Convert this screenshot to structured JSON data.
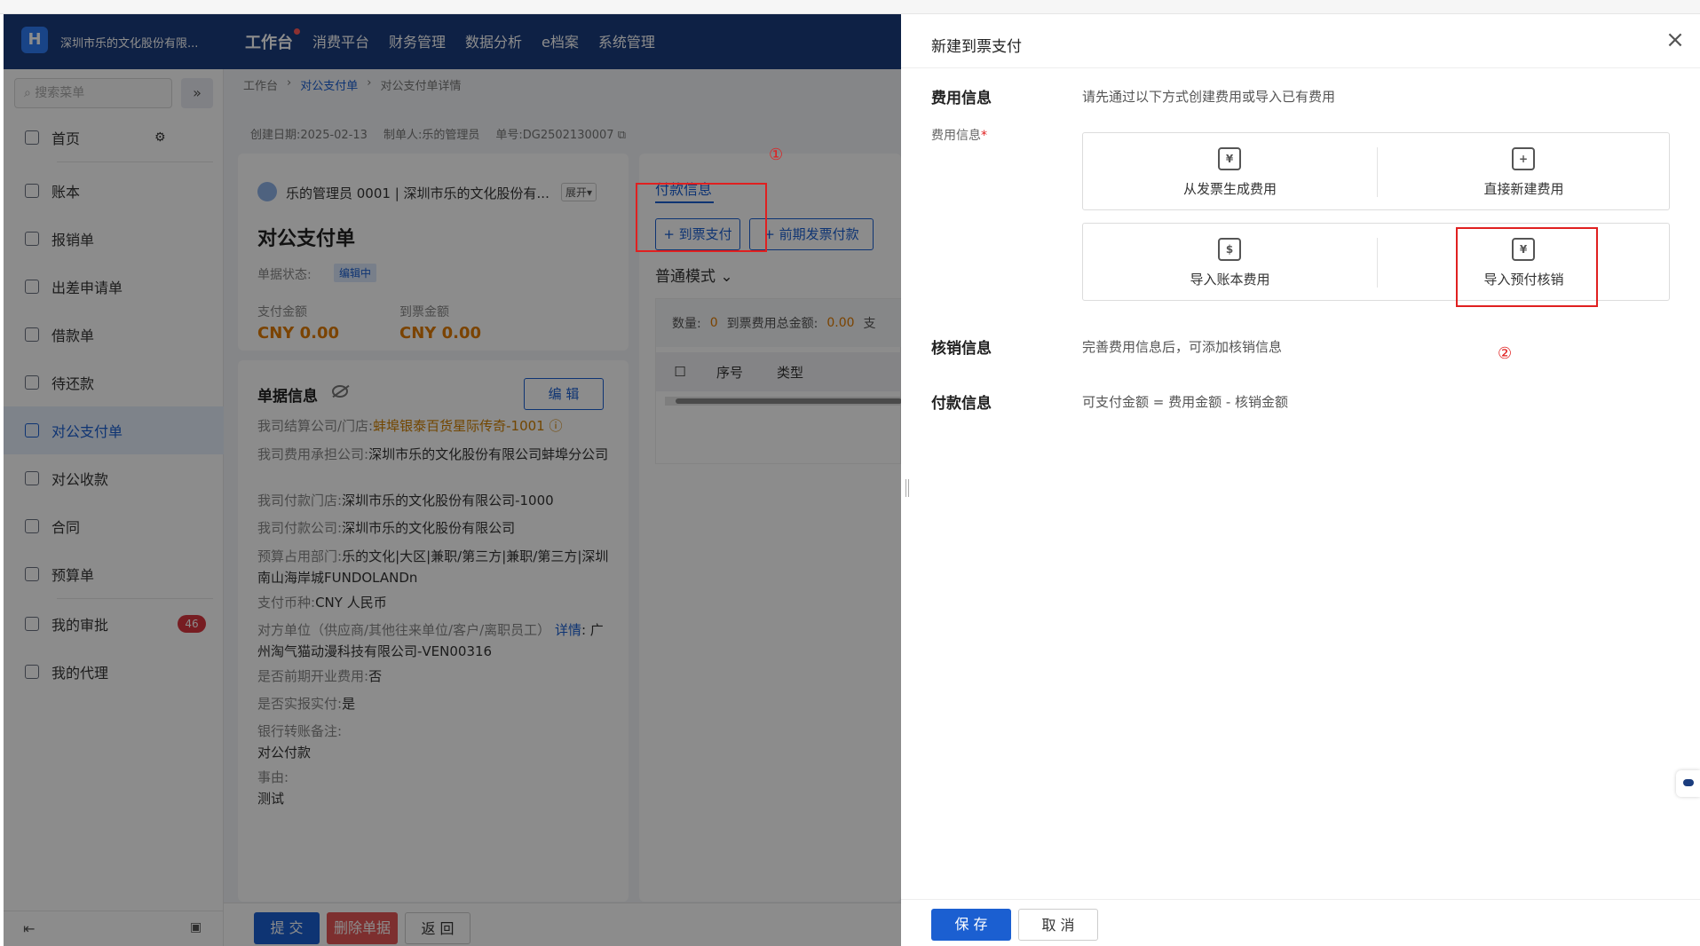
{
  "header": {
    "company": "深圳市乐的文化股份有限...",
    "nav": [
      "工作台",
      "消费平台",
      "财务管理",
      "数据分析",
      "e档案",
      "系统管理"
    ],
    "active_nav": "工作台"
  },
  "sidebar": {
    "search_placeholder": "搜索菜单",
    "items": [
      {
        "label": "首页"
      },
      {
        "label": "账本"
      },
      {
        "label": "报销单"
      },
      {
        "label": "出差申请单"
      },
      {
        "label": "借款单"
      },
      {
        "label": "待还款"
      },
      {
        "label": "对公支付单"
      },
      {
        "label": "对公收款"
      },
      {
        "label": "合同"
      },
      {
        "label": "预算单"
      },
      {
        "label": "我的审批",
        "badge": "46"
      },
      {
        "label": "我的代理"
      }
    ],
    "active_item": "对公支付单"
  },
  "breadcrumb": [
    "工作台",
    "对公支付单",
    "对公支付单详情"
  ],
  "doc_meta": {
    "created_label": "创建日期:",
    "created": "2025-02-13",
    "maker_label": "制单人:",
    "maker": "乐的管理员",
    "no_label": "单号:",
    "no": "DG2502130007"
  },
  "summary": {
    "user": "乐的管理员 0001 | 深圳市乐的文化股份有...",
    "expand": "展开▾",
    "title": "对公支付单",
    "status_label": "单据状态:",
    "status": "编辑中",
    "pay_label": "支付金额",
    "pay_value": "CNY 0.00",
    "invoice_label": "到票金额",
    "invoice_value": "CNY 0.00"
  },
  "doc_info": {
    "title": "单据信息",
    "edit": "编 辑",
    "fields": [
      {
        "k": "我司结算公司/门店:",
        "v": "蚌埠银泰百货星际传奇-1001 ⓘ"
      },
      {
        "k": "我司费用承担公司:",
        "v": "深圳市乐的文化股份有限公司蚌埠分公司"
      },
      {
        "k": "我司付款门店:",
        "v": "深圳市乐的文化股份有限公司-1000"
      },
      {
        "k": "我司付款公司:",
        "v": "深圳市乐的文化股份有限公司"
      },
      {
        "k": "预算占用部门:",
        "v": "乐的文化|大区|兼职/第三方|兼职/第三方|深圳南山海岸城FUNDOLANDn"
      },
      {
        "k": "支付币种:",
        "v": "CNY 人民币"
      },
      {
        "k": "对方单位（供应商/其他往来单位/客户/离职员工）",
        "link": "详情",
        "v": ": 广州淘气猫动漫科技有限公司-VEN00316"
      },
      {
        "k": "是否前期开业费用:",
        "v": "否"
      },
      {
        "k": "是否实报实付:",
        "v": "是"
      },
      {
        "k": "银行转账备注:",
        "v": "对公付款"
      },
      {
        "k": "事由:",
        "v": "测试"
      }
    ]
  },
  "payment": {
    "tab": "付款信息",
    "btn1": "+ 到票支付",
    "btn2": "+ 前期发票付款",
    "mode": "普通模式 ⌄",
    "count_label": "数量:",
    "count": "0",
    "total_label": "到票费用总金额:",
    "total": "0.00",
    "trunc": "支",
    "cols": [
      "序号",
      "类型"
    ]
  },
  "footer_buttons": {
    "submit": "提 交",
    "delete": "删除单据",
    "back": "返 回"
  },
  "annotations": {
    "one": "①",
    "two": "②"
  },
  "drawer": {
    "title": "新建到票支付",
    "fee_label": "费用信息",
    "fee_hint": "请先通过以下方式创建费用或导入已有费用",
    "fee_sub": "费用信息",
    "options": [
      {
        "label": "从发票生成费用",
        "icon": "¥"
      },
      {
        "label": "直接新建费用",
        "icon": "+"
      },
      {
        "label": "导入账本费用",
        "icon": "$"
      },
      {
        "label": "导入预付核销",
        "icon": "¥"
      }
    ],
    "verify_label": "核销信息",
    "verify_hint": "完善费用信息后，可添加核销信息",
    "pay_label": "付款信息",
    "pay_hint": "可支付金额 = 费用金额 - 核销金额",
    "save": "保 存",
    "cancel": "取 消"
  },
  "colors": {
    "brand": "#1b3d7e",
    "primary": "#1b5fd1",
    "amount": "#e07b00",
    "danger": "#e02020"
  }
}
